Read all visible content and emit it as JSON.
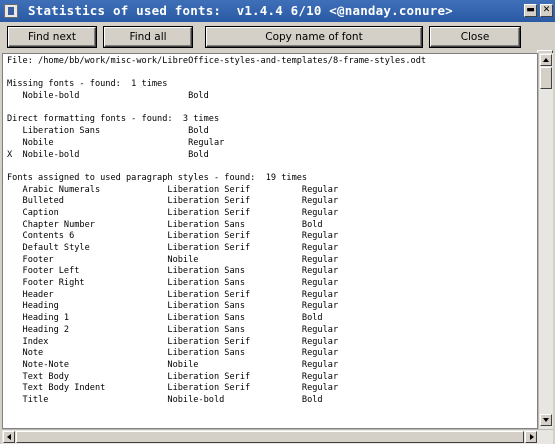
{
  "window": {
    "title": "Statistics of used fonts:  v1.4.4 6/10 <@nanday.conure>",
    "min_glyph": "▬",
    "close_glyph": "✕",
    "icon": "document-icon"
  },
  "toolbar": {
    "find_next": "Find next",
    "find_all": "Find all",
    "copy_name": "Copy name of font",
    "close": "Close"
  },
  "content": {
    "lines": [
      "File: /home/bb/work/misc-work/LibreOffice-styles-and-templates/8-frame-styles.odt",
      "",
      "Missing fonts - found:  1 times",
      "   Nobile-bold                     Bold",
      "",
      "Direct formatting fonts - found:  3 times",
      "   Liberation Sans                 Bold",
      "   Nobile                          Regular",
      "X  Nobile-bold                     Bold",
      "",
      "Fonts assigned to used paragraph styles - found:  19 times",
      "   Arabic Numerals             Liberation Serif          Regular",
      "   Bulleted                    Liberation Serif          Regular",
      "   Caption                     Liberation Serif          Regular",
      "   Chapter Number              Liberation Sans           Bold",
      "   Contents 6                  Liberation Serif          Regular",
      "   Default Style               Liberation Serif          Regular",
      "   Footer                      Nobile                    Regular",
      "   Footer Left                 Liberation Sans           Regular",
      "   Footer Right                Liberation Sans           Regular",
      "   Header                      Liberation Serif          Regular",
      "   Heading                     Liberation Sans           Regular",
      "   Heading 1                   Liberation Sans           Bold",
      "   Heading 2                   Liberation Sans           Regular",
      "   Index                       Liberation Serif          Regular",
      "   Note                        Liberation Sans           Regular",
      "   Note-Note                   Nobile                    Regular",
      "   Text Body                   Liberation Serif          Regular",
      "   Text Body Indent            Liberation Serif          Regular",
      "   Title                       Nobile-bold               Bold",
      "",
      ""
    ]
  },
  "colors": {
    "titlebar": "#2a5aa3",
    "chrome": "#d4d0c8",
    "text_bg": "#ffffff"
  }
}
